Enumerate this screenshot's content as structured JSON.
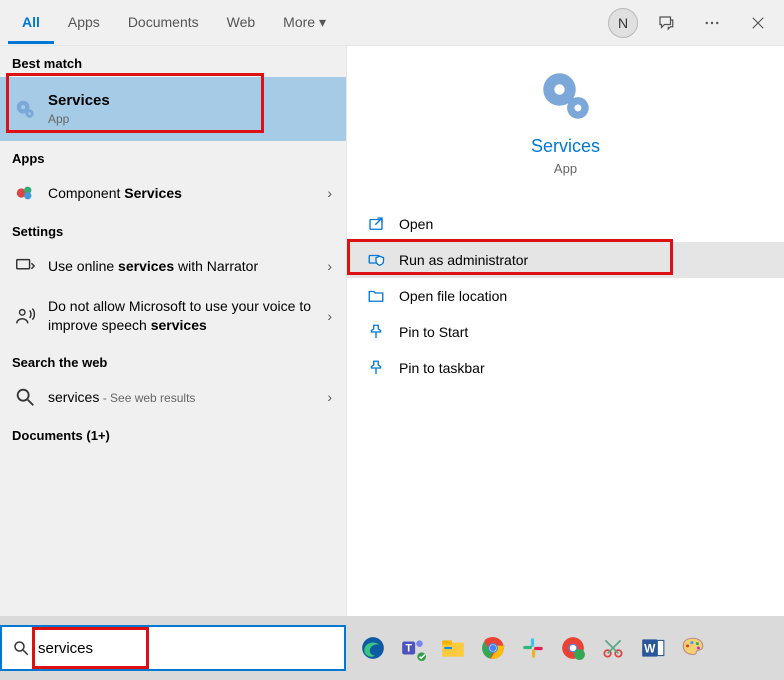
{
  "tabs": {
    "all": "All",
    "apps": "Apps",
    "documents": "Documents",
    "web": "Web",
    "more": "More"
  },
  "header": {
    "avatar_initial": "N"
  },
  "sections": {
    "best_match": "Best match",
    "apps": "Apps",
    "settings": "Settings",
    "search_web": "Search the web",
    "documents": "Documents (1+)"
  },
  "best_match_item": {
    "title": "Services",
    "sub": "App"
  },
  "app_items": {
    "component_services_pre": "Component ",
    "component_services_bold": "Services"
  },
  "settings_items": {
    "narrator_pre": "Use online ",
    "narrator_bold": "services",
    "narrator_post": " with Narrator",
    "speech_pre": "Do not allow Microsoft to use your voice to improve speech ",
    "speech_bold": "services"
  },
  "web_item": {
    "query": "services",
    "suffix": " - See web results"
  },
  "detail": {
    "title": "Services",
    "sub": "App"
  },
  "actions": {
    "open": "Open",
    "run_admin": "Run as administrator",
    "open_loc": "Open file location",
    "pin_start": "Pin to Start",
    "pin_taskbar": "Pin to taskbar"
  },
  "search": {
    "value": "services"
  }
}
